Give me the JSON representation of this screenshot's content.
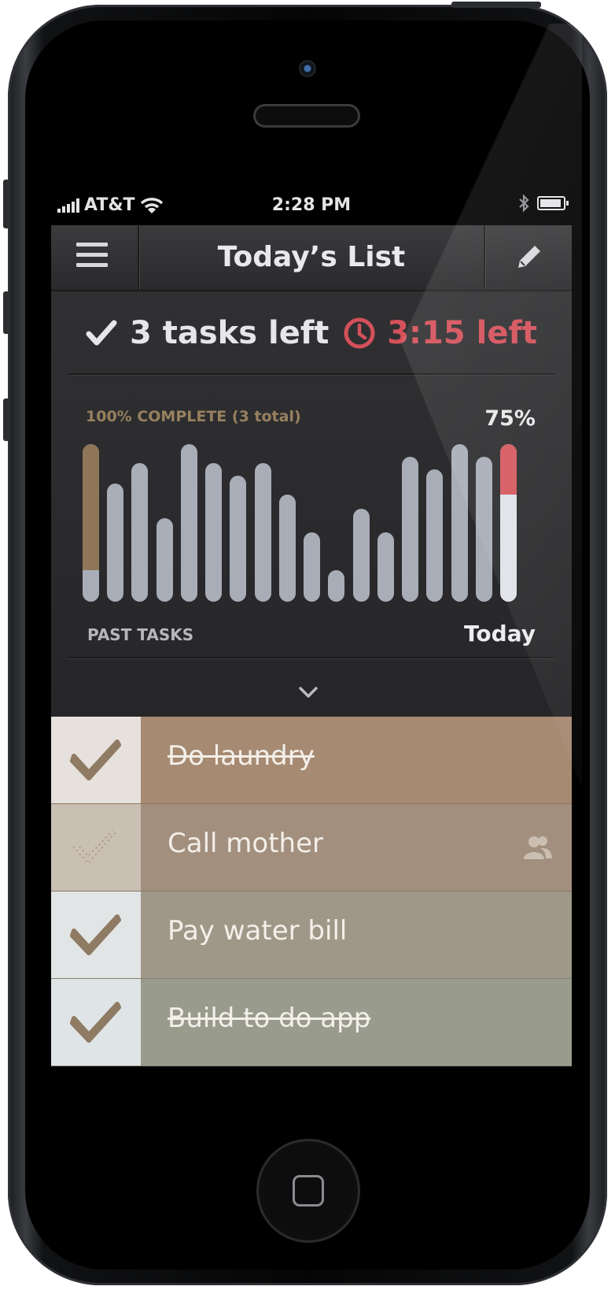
{
  "status_bar": {
    "carrier": "AT&T",
    "time": "2:28 PM"
  },
  "nav": {
    "title": "Today’s List"
  },
  "summary": {
    "tasks_left": "3 tasks left",
    "time_left": "3:15 left",
    "complete_label": "100% COMPLETE (3 total)",
    "today_percent": "75%",
    "past_label": "PAST TASKS",
    "today_label": "Today"
  },
  "chart_data": {
    "type": "bar",
    "bars": [
      {
        "value": 0.2,
        "highlight": "past-complete",
        "highlight_to": 1.0
      },
      {
        "value": 0.75
      },
      {
        "value": 0.88
      },
      {
        "value": 0.53
      },
      {
        "value": 1.0
      },
      {
        "value": 0.88
      },
      {
        "value": 0.8
      },
      {
        "value": 0.88
      },
      {
        "value": 0.68
      },
      {
        "value": 0.44
      },
      {
        "value": 0.2
      },
      {
        "value": 0.59
      },
      {
        "value": 0.44
      },
      {
        "value": 0.92
      },
      {
        "value": 0.84
      },
      {
        "value": 1.0
      },
      {
        "value": 0.92
      },
      {
        "value": 0.68,
        "highlight": "today",
        "highlight_to": 1.0
      }
    ],
    "colors": {
      "bar": "#a8adb8",
      "past_complete": "#8f7658",
      "today": "#dfe2e7",
      "today_remaining": "#d5585e"
    }
  },
  "tasks": [
    {
      "label": "Do laundry",
      "done": true,
      "checkbox": "filled-check",
      "row_color": "#a68a72",
      "box_color": "#e6e1dc"
    },
    {
      "label": "Call mother",
      "done": false,
      "checkbox": "dotted-check",
      "row_color": "#a28f7d",
      "box_color": "#c9bfb3",
      "extra_icon": "people-icon"
    },
    {
      "label": "Pay water bill",
      "done": false,
      "checkbox": "filled-check",
      "row_color": "#9f9888",
      "box_color": "#e2e5e6"
    },
    {
      "label": "Build to do app",
      "done": true,
      "checkbox": "filled-check",
      "row_color": "#999b8d",
      "box_color": "#dfe4e6"
    }
  ],
  "colors": {
    "accent_red": "#d4505a",
    "label_brown": "#97815f"
  }
}
